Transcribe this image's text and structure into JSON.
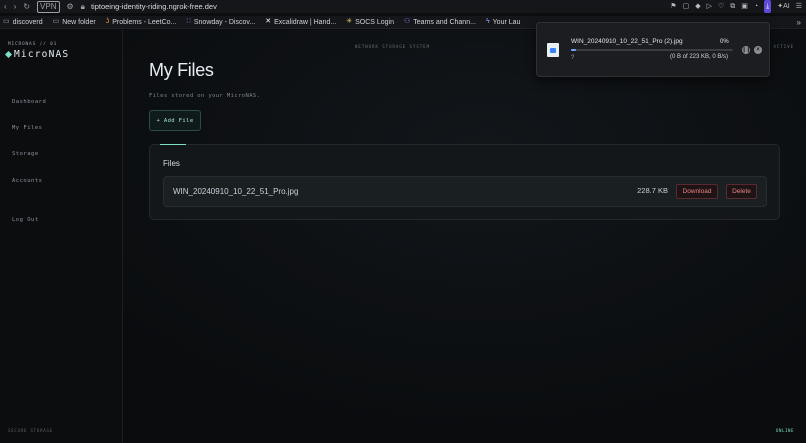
{
  "browser": {
    "url": "tiptoeing-identity-riding.ngrok-free.dev",
    "vpn_label": "VPN",
    "ai_label": "AI",
    "bookmarks": [
      {
        "label": "discoverd",
        "icon": "folder-icon"
      },
      {
        "label": "New folder",
        "icon": "folder-icon"
      },
      {
        "label": "Problems - LeetCo...",
        "icon": "leetcode-icon"
      },
      {
        "label": "Snowday - Discov...",
        "icon": "discord-icon"
      },
      {
        "label": "Excalidraw | Hand...",
        "icon": "excalidraw-icon"
      },
      {
        "label": "SOCS Login",
        "icon": "star-icon"
      },
      {
        "label": "Teams and Chann...",
        "icon": "teams-icon"
      },
      {
        "label": "Your Lau",
        "icon": "bolt-icon"
      }
    ]
  },
  "sidebar": {
    "brand_sub": "MICRONAS // 01",
    "brand": "MicroNAS",
    "items": [
      {
        "label": "Dashboard"
      },
      {
        "label": "My Files"
      },
      {
        "label": "Storage"
      },
      {
        "label": "Accounts"
      },
      {
        "label": "Log Out"
      }
    ],
    "footer": "SECURE STORAGE"
  },
  "header": {
    "system_label": "NETWORK STORAGE SYSTEM",
    "status": "ACTIVE"
  },
  "main": {
    "title": "My Files",
    "subtitle": "Files stored on your MicroNAS.",
    "add_button": "+ Add File",
    "files_panel": {
      "title": "Files",
      "files": [
        {
          "name": "WIN_20240910_10_22_51_Pro.jpg",
          "size": "228.7 KB",
          "download_label": "Download",
          "delete_label": "Delete"
        }
      ]
    }
  },
  "footer_status": "ONLINE",
  "download_popup": {
    "file_name": "WIN_20240910_10_22_51_Pro (2).jpg",
    "percent": "0%",
    "progress": 0.03,
    "question": "?",
    "status": "(0 B of 223 KB, 0 B/s)"
  },
  "colors": {
    "accent": "#7ee0c9",
    "danger": "#e8837f",
    "download_highlight": "#5b4bd6"
  }
}
